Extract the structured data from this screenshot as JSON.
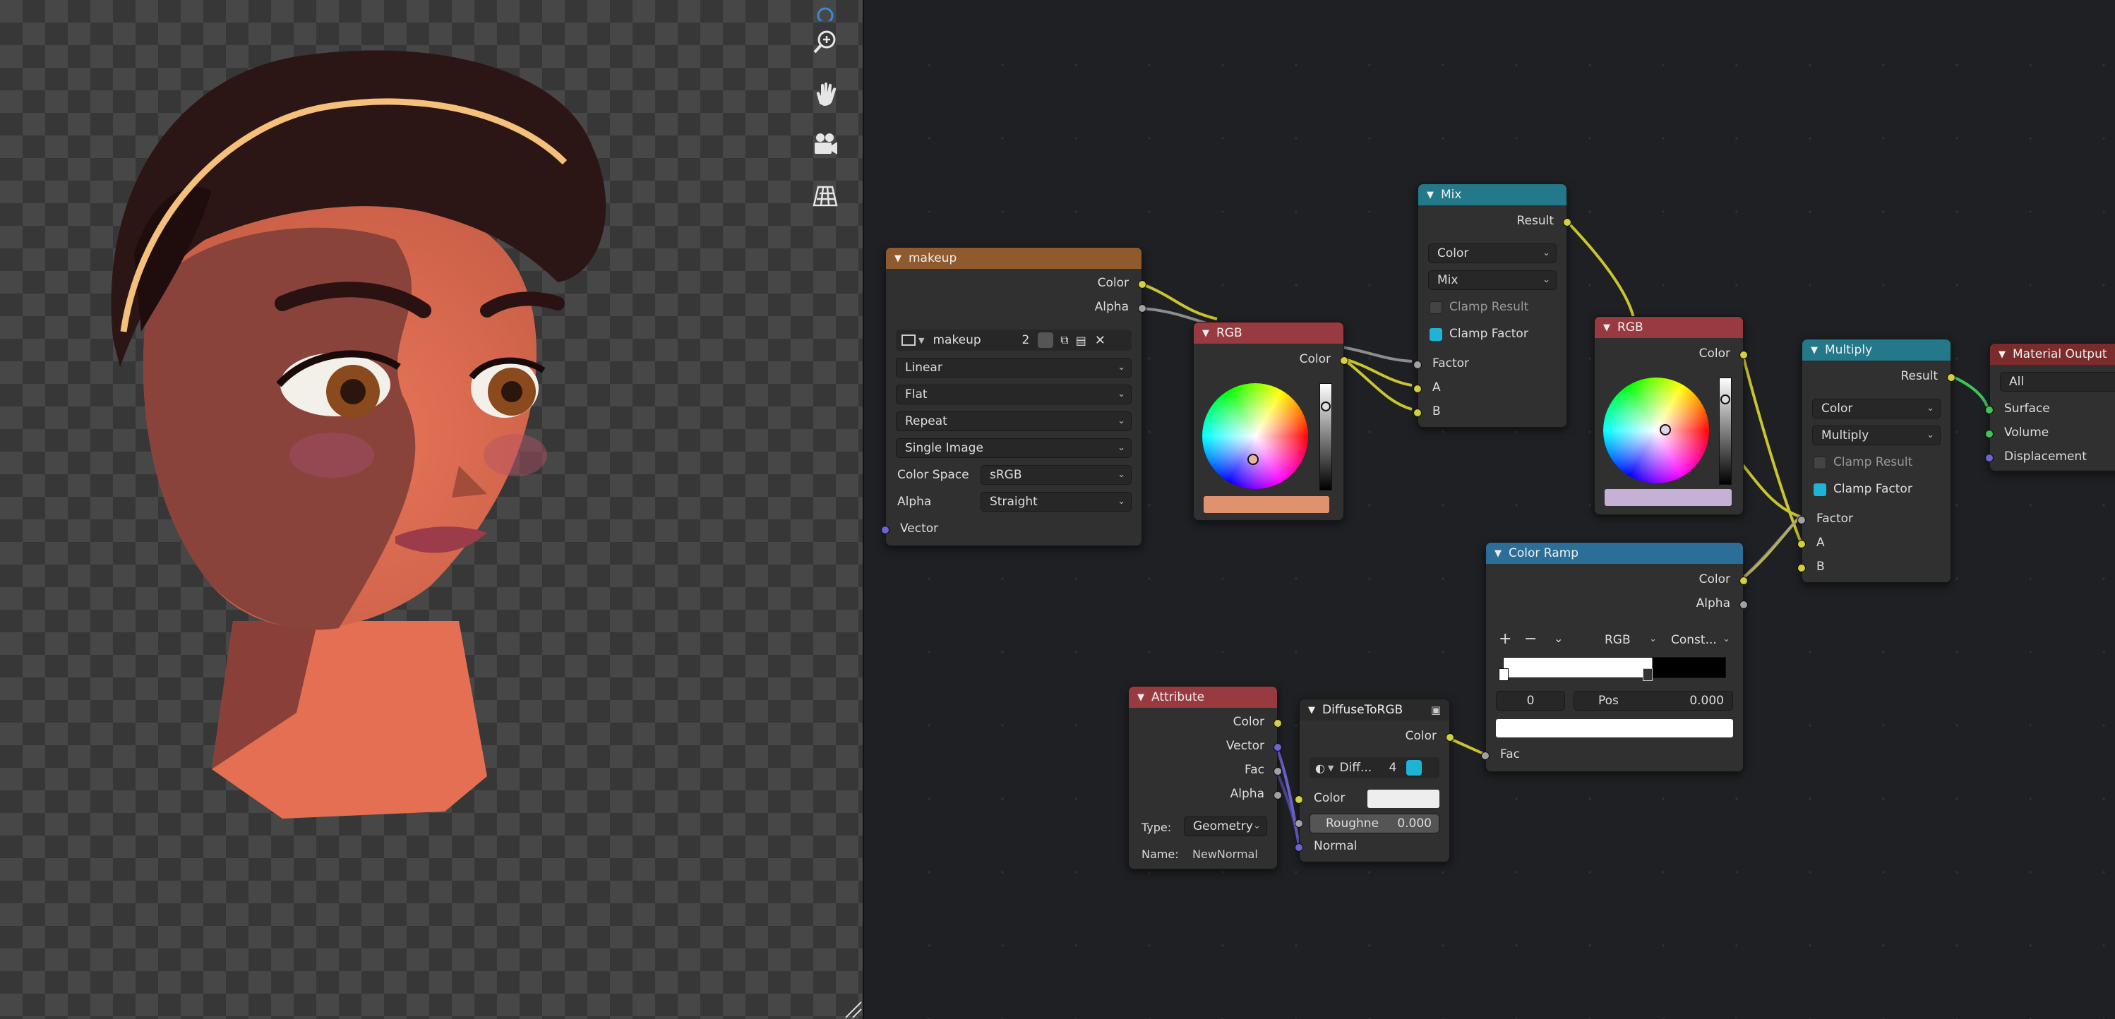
{
  "nodes": {
    "makeup": {
      "title": "makeup",
      "outputs": [
        "Color",
        "Alpha"
      ],
      "image_name": "makeup",
      "users": "2",
      "interpolation": "Linear",
      "projection": "Flat",
      "extension": "Repeat",
      "source": "Single Image",
      "color_space_label": "Color Space",
      "color_space": "sRGB",
      "alpha_label": "Alpha",
      "alpha": "Straight",
      "input": "Vector"
    },
    "rgb1": {
      "title": "RGB",
      "output": "Color",
      "swatch": "#e0916e"
    },
    "mix": {
      "title": "Mix",
      "output": "Result",
      "data_type": "Color",
      "blend": "Mix",
      "clamp_result": "Clamp Result",
      "clamp_factor": "Clamp Factor",
      "inputs": [
        "Factor",
        "A",
        "B"
      ]
    },
    "rgb2": {
      "title": "RGB",
      "output": "Color",
      "swatch": "#c5b1d6"
    },
    "multiply": {
      "title": "Multiply",
      "output": "Result",
      "data_type": "Color",
      "blend": "Multiply",
      "clamp_result": "Clamp Result",
      "clamp_factor": "Clamp Factor",
      "inputs": [
        "Factor",
        "A",
        "B"
      ]
    },
    "material_output": {
      "title": "Material Output",
      "target": "All",
      "inputs": [
        "Surface",
        "Volume",
        "Displacement"
      ]
    },
    "color_ramp": {
      "title": "Color Ramp",
      "outputs": [
        "Color",
        "Alpha"
      ],
      "color_mode": "RGB",
      "interpolation": "Const...",
      "stop_index": "0",
      "pos_label": "Pos",
      "pos_value": "0.000",
      "input": "Fac"
    },
    "attribute": {
      "title": "Attribute",
      "outputs": [
        "Color",
        "Vector",
        "Fac",
        "Alpha"
      ],
      "type_label": "Type:",
      "type_value": "Geometry",
      "name_label": "Name:",
      "name_value": "NewNormal"
    },
    "diffuse": {
      "title": "DiffuseToRGB",
      "output": "Color",
      "group_name": "Diff...",
      "users": "4",
      "inputs": [
        "Color",
        "Roughne",
        "Normal"
      ],
      "roughness_value": "0.000"
    }
  },
  "colors": {
    "header_image": "#8f5a2e",
    "header_color": "#983a3f",
    "header_converter": "#23798a",
    "header_output": "#7a2b2b",
    "header_ramp": "#2b6f99",
    "header_group": "#2a2a2a"
  },
  "icons": [
    "zoom-icon",
    "hand-icon",
    "camera-icon",
    "grid-icon"
  ]
}
